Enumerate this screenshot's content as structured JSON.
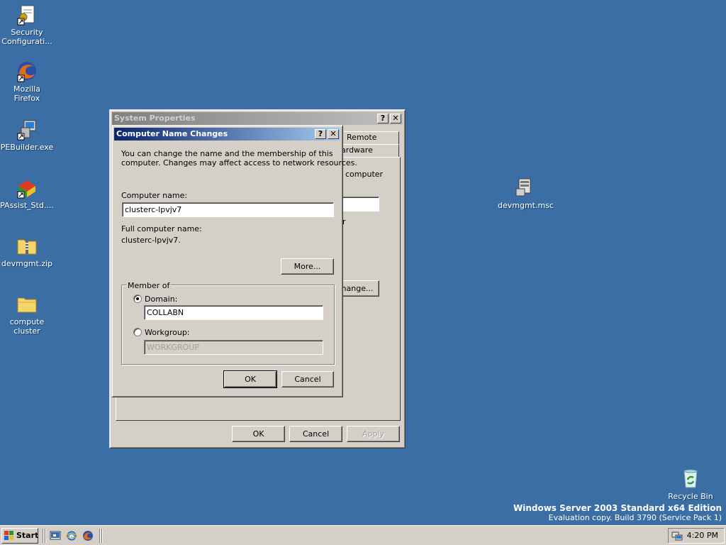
{
  "desktop": {
    "icons": [
      {
        "name": "security-configuration-icon",
        "label": "Security Configurati..."
      },
      {
        "name": "firefox-icon",
        "label": "Mozilla Firefox"
      },
      {
        "name": "pebuilder-icon",
        "label": "PEBuilder.exe"
      },
      {
        "name": "passist-icon",
        "label": "PAssist_Std...."
      },
      {
        "name": "zip-folder-icon",
        "label": "devmgmt.zip"
      },
      {
        "name": "folder-icon",
        "label": "compute cluster"
      },
      {
        "name": "msc-console-icon",
        "label": "devmgmt.msc"
      },
      {
        "name": "recycle-bin-icon",
        "label": "Recycle Bin"
      }
    ],
    "watermark": {
      "line1": "Windows Server 2003 Standard x64 Edition",
      "line2": "Evaluation copy. Build 3790 (Service Pack 1)"
    }
  },
  "system_properties": {
    "title": "System Properties",
    "tabs": [
      "Remote",
      "ardware"
    ],
    "partial_texts": [
      "computer",
      "r"
    ],
    "change_button": "hange...",
    "ok": "OK",
    "cancel": "Cancel",
    "apply": "Apply"
  },
  "dialog": {
    "title": "Computer Name Changes",
    "description_line1": "You can change the name and the membership of this",
    "description_line2": "computer. Changes may affect access to network resources.",
    "computer_name_label": "Computer name:",
    "computer_name_value": "clusterc-lpvjv7",
    "full_name_label": "Full computer name:",
    "full_name_value": "clusterc-lpvjv7.",
    "more_button": "More...",
    "member_of": "Member of",
    "domain_label": "Domain:",
    "domain_value": "COLLABN",
    "workgroup_label": "Workgroup:",
    "workgroup_value": "WORKGROUP",
    "ok": "OK",
    "cancel": "Cancel"
  },
  "taskbar": {
    "start": "Start",
    "quicklaunch": [
      "show-desktop-icon",
      "internet-explorer-icon",
      "firefox-icon"
    ],
    "clock": "4:20 PM"
  },
  "colors": {
    "desktop": "#3a6ea5",
    "active_title": "#0a246a",
    "face": "#d4d0c8"
  }
}
